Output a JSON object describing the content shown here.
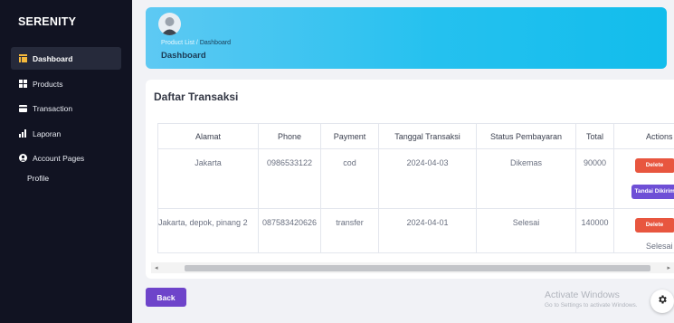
{
  "sidebar": {
    "brand": "SERENITY",
    "items": [
      {
        "label": "Dashboard",
        "icon": "dashboard-icon",
        "active": true
      },
      {
        "label": "Products",
        "icon": "products-icon"
      },
      {
        "label": "Transaction",
        "icon": "card-icon"
      },
      {
        "label": "Laporan",
        "icon": "bar-chart-icon"
      },
      {
        "label": "Account Pages",
        "icon": "user-icon"
      }
    ],
    "sub_items": [
      "Profile"
    ]
  },
  "header": {
    "breadcrumb_parent": "Product List",
    "breadcrumb_sep": "/",
    "breadcrumb_current": "Dashboard",
    "title": "Dashboard"
  },
  "main": {
    "title": "Daftar Transaksi",
    "columns": [
      "Alamat",
      "Phone",
      "Payment",
      "Tanggal Transaksi",
      "Status Pembayaran",
      "Total",
      "Actions"
    ],
    "rows": [
      {
        "alamat": "Jakarta",
        "phone": "0986533122",
        "payment": "cod",
        "tanggal": "2024-04-03",
        "status": "Dikemas",
        "total": "90000",
        "delete_label": "Delete",
        "ship_label": "Tandai Dikirim"
      },
      {
        "alamat": "Jakarta, depok, pinang 2",
        "phone": "087583420626",
        "payment": "transfer",
        "tanggal": "2024-04-01",
        "status": "Selesai",
        "total": "140000",
        "delete_label": "Delete",
        "action_text": "Selesai"
      }
    ]
  },
  "footer": {
    "back_label": "Back"
  },
  "watermark": {
    "line1": "Activate Windows",
    "line2": "Go to Settings to activate Windows."
  },
  "colors": {
    "sidebar_bg": "#111322",
    "banner_start": "#5ec9f3",
    "banner_end": "#12bdec",
    "delete": "#e8563f",
    "ship": "#6e4fd6",
    "back": "#6e44ca"
  }
}
